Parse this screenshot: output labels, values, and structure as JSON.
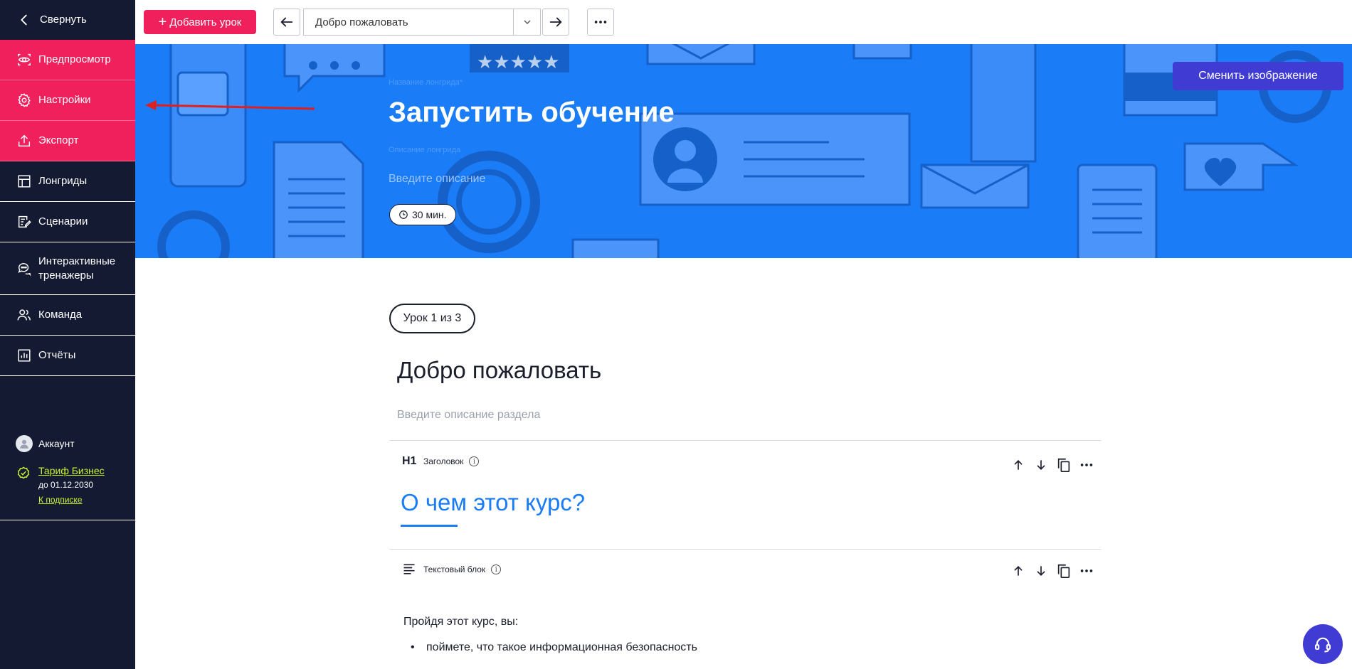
{
  "sidebar": {
    "collapse_label": "Свернуть",
    "items": [
      {
        "label": "Предпросмотр",
        "icon": "preview-icon"
      },
      {
        "label": "Настройки",
        "icon": "gear-icon"
      },
      {
        "label": "Экспорт",
        "icon": "export-icon"
      },
      {
        "label": "Лонгриды",
        "icon": "longread-icon"
      },
      {
        "label": "Сценарии",
        "icon": "scenario-icon"
      },
      {
        "label": "Интерактивные тренажеры",
        "icon": "chat-trainer-icon"
      },
      {
        "label": "Команда",
        "icon": "team-icon"
      },
      {
        "label": "Отчёты",
        "icon": "reports-icon"
      }
    ],
    "account_label": "Аккаунт",
    "tariff_label": "Тариф Бизнес",
    "tariff_until": "до 01.12.2030",
    "tariff_subscription": "К подписке"
  },
  "toolbar": {
    "add_lesson": "Добавить урок",
    "current_lesson": "Добро пожаловать"
  },
  "banner": {
    "tag": "Название лонгрида*",
    "title": "Запустить обучение",
    "desc_label": "Описание лонгрида",
    "desc_placeholder": "Введите описание",
    "duration": "30 мин.",
    "change_image": "Сменить изображение"
  },
  "content": {
    "lesson_counter": "Урок 1 из 3",
    "section_title": "Добро пожаловать",
    "section_desc_placeholder": "Введите описание раздела",
    "blocks": [
      {
        "type_icon": "H1",
        "type_label": "Заголовок",
        "heading": "О чем этот курс?"
      },
      {
        "type_label": "Текстовый блок",
        "paragraph": "Пройдя этот курс, вы:",
        "list": [
          "поймете, что такое информационная безопасность"
        ]
      }
    ]
  },
  "colors": {
    "sidebar_bg": "#151a33",
    "accent_pink": "#f0205c",
    "banner_blue": "#1a7cf6",
    "button_purple": "#3f3bd3",
    "tariff_green": "#c8f230"
  }
}
